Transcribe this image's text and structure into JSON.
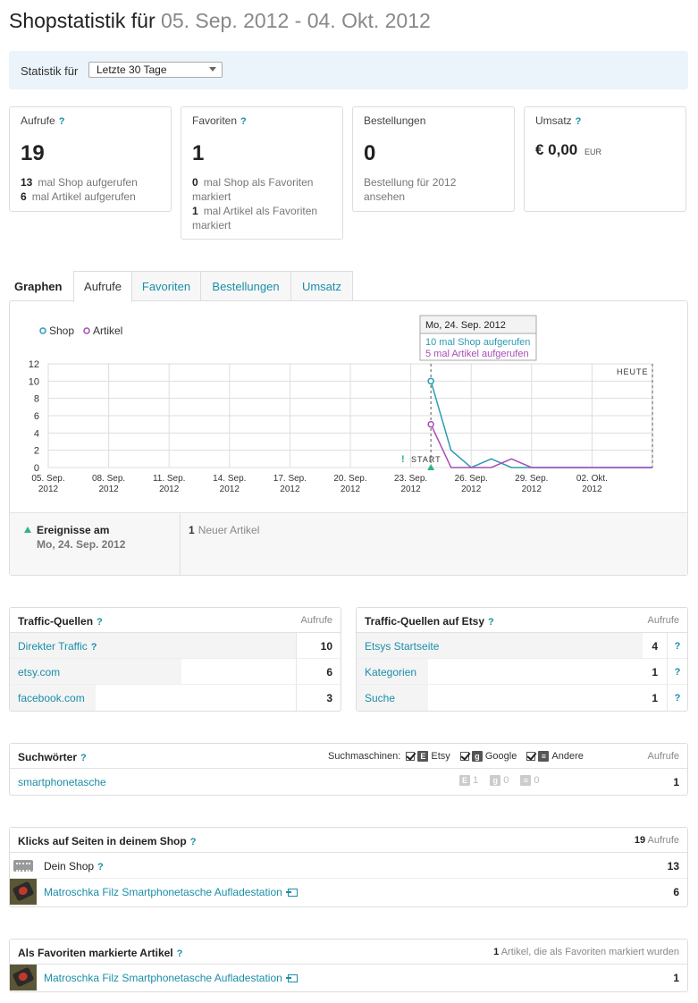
{
  "title": {
    "prefix": "Shopstatistik für",
    "range": "05. Sep. 2012 - 04. Okt. 2012"
  },
  "filter": {
    "label": "Statistik für",
    "selected": "Letzte 30 Tage"
  },
  "cards": {
    "aufrufe": {
      "title": "Aufrufe",
      "help": "?",
      "value": "19",
      "line1_num": "13",
      "line1_text": "mal Shop aufgerufen",
      "line2_num": "6",
      "line2_text": "mal Artikel aufgerufen"
    },
    "favoriten": {
      "title": "Favoriten",
      "help": "?",
      "value": "1",
      "line1_num": "0",
      "line1_text": "mal Shop als Favoriten",
      "line1b_text": "markiert",
      "line2_num": "1",
      "line2_text": "mal Artikel als Favoriten",
      "line2b_text": "markiert"
    },
    "bestellungen": {
      "title": "Bestellungen",
      "value": "0",
      "link1": "Bestellung für 2012",
      "link2": "ansehen"
    },
    "umsatz": {
      "title": "Umsatz",
      "help": "?",
      "value": "€ 0,00",
      "currency": "EUR"
    }
  },
  "graph": {
    "heading": "Graphen",
    "tabs": [
      "Aufrufe",
      "Favoriten",
      "Bestellungen",
      "Umsatz"
    ],
    "active_tab": "Aufrufe",
    "legend_shop": "Shop",
    "legend_artikel": "Artikel",
    "tooltip_date": "Mo, 24. Sep. 2012",
    "tooltip_shop": "10 mal Shop aufgerufen",
    "tooltip_artikel": "5 mal Artikel aufgerufen",
    "today_label": "HEUTE",
    "start_label": "START",
    "events_title": "Ereignisse am",
    "events_date": "Mo, 24. Sep. 2012",
    "events_count": "1",
    "events_text": "Neuer Artikel"
  },
  "chart_data": {
    "type": "line",
    "ylim": [
      0,
      12
    ],
    "yticks": [
      0,
      2,
      4,
      6,
      8,
      10,
      12
    ],
    "x_tick_labels": [
      [
        "05. Sep.",
        "2012"
      ],
      [
        "08. Sep.",
        "2012"
      ],
      [
        "11. Sep.",
        "2012"
      ],
      [
        "14. Sep.",
        "2012"
      ],
      [
        "17. Sep.",
        "2012"
      ],
      [
        "20. Sep.",
        "2012"
      ],
      [
        "23. Sep.",
        "2012"
      ],
      [
        "26. Sep.",
        "2012"
      ],
      [
        "29. Sep.",
        "2012"
      ],
      [
        "02. Okt.",
        "2012"
      ]
    ],
    "x_days": 30,
    "start_day": 19,
    "series": [
      {
        "name": "Shop",
        "color": "#2a9bb5",
        "start_day": 19,
        "values": [
          10,
          2,
          0,
          1,
          0,
          0,
          0,
          0,
          0,
          0,
          0,
          0
        ]
      },
      {
        "name": "Artikel",
        "color": "#a84cb8",
        "start_day": 19,
        "values": [
          5,
          0,
          0,
          0,
          1,
          0,
          0,
          0,
          0,
          0,
          0,
          0
        ]
      }
    ]
  },
  "traffic": {
    "title": "Traffic-Quellen",
    "col": "Aufrufe",
    "rows": [
      {
        "label": "Direkter Traffic",
        "value": "10",
        "fraction": 1.0,
        "help": "?"
      },
      {
        "label": "etsy.com",
        "value": "6",
        "fraction": 0.6
      },
      {
        "label": "facebook.com",
        "value": "3",
        "fraction": 0.3
      }
    ]
  },
  "etsy_traffic": {
    "title": "Traffic-Quellen auf Etsy",
    "col": "Aufrufe",
    "rows": [
      {
        "label": "Etsys Startseite",
        "value": "4",
        "fraction": 1.0
      },
      {
        "label": "Kategorien",
        "value": "1",
        "fraction": 0.25
      },
      {
        "label": "Suche",
        "value": "1",
        "fraction": 0.25
      }
    ]
  },
  "search": {
    "title": "Suchwörter",
    "engines_label": "Suchmaschinen:",
    "col": "Aufrufe",
    "engines": [
      "Etsy",
      "Google",
      "Andere"
    ],
    "row_label": "smartphonetasche",
    "etsy": "1",
    "google": "0",
    "other": "0",
    "value": "1"
  },
  "clicks": {
    "title": "Klicks auf Seiten in deinem Shop",
    "total": "19",
    "total_label": "Aufrufe",
    "rows": [
      {
        "label": "Dein Shop",
        "value": "13"
      },
      {
        "label": "Matroschka Filz Smartphonetasche Aufladestation",
        "value": "6"
      }
    ]
  },
  "favs": {
    "title": "Als Favoriten markierte Artikel",
    "count": "1",
    "count_label": "Artikel, die als Favoriten markiert wurden",
    "rows": [
      {
        "label": "Matroschka Filz Smartphonetasche Aufladestation",
        "value": "1"
      }
    ]
  }
}
